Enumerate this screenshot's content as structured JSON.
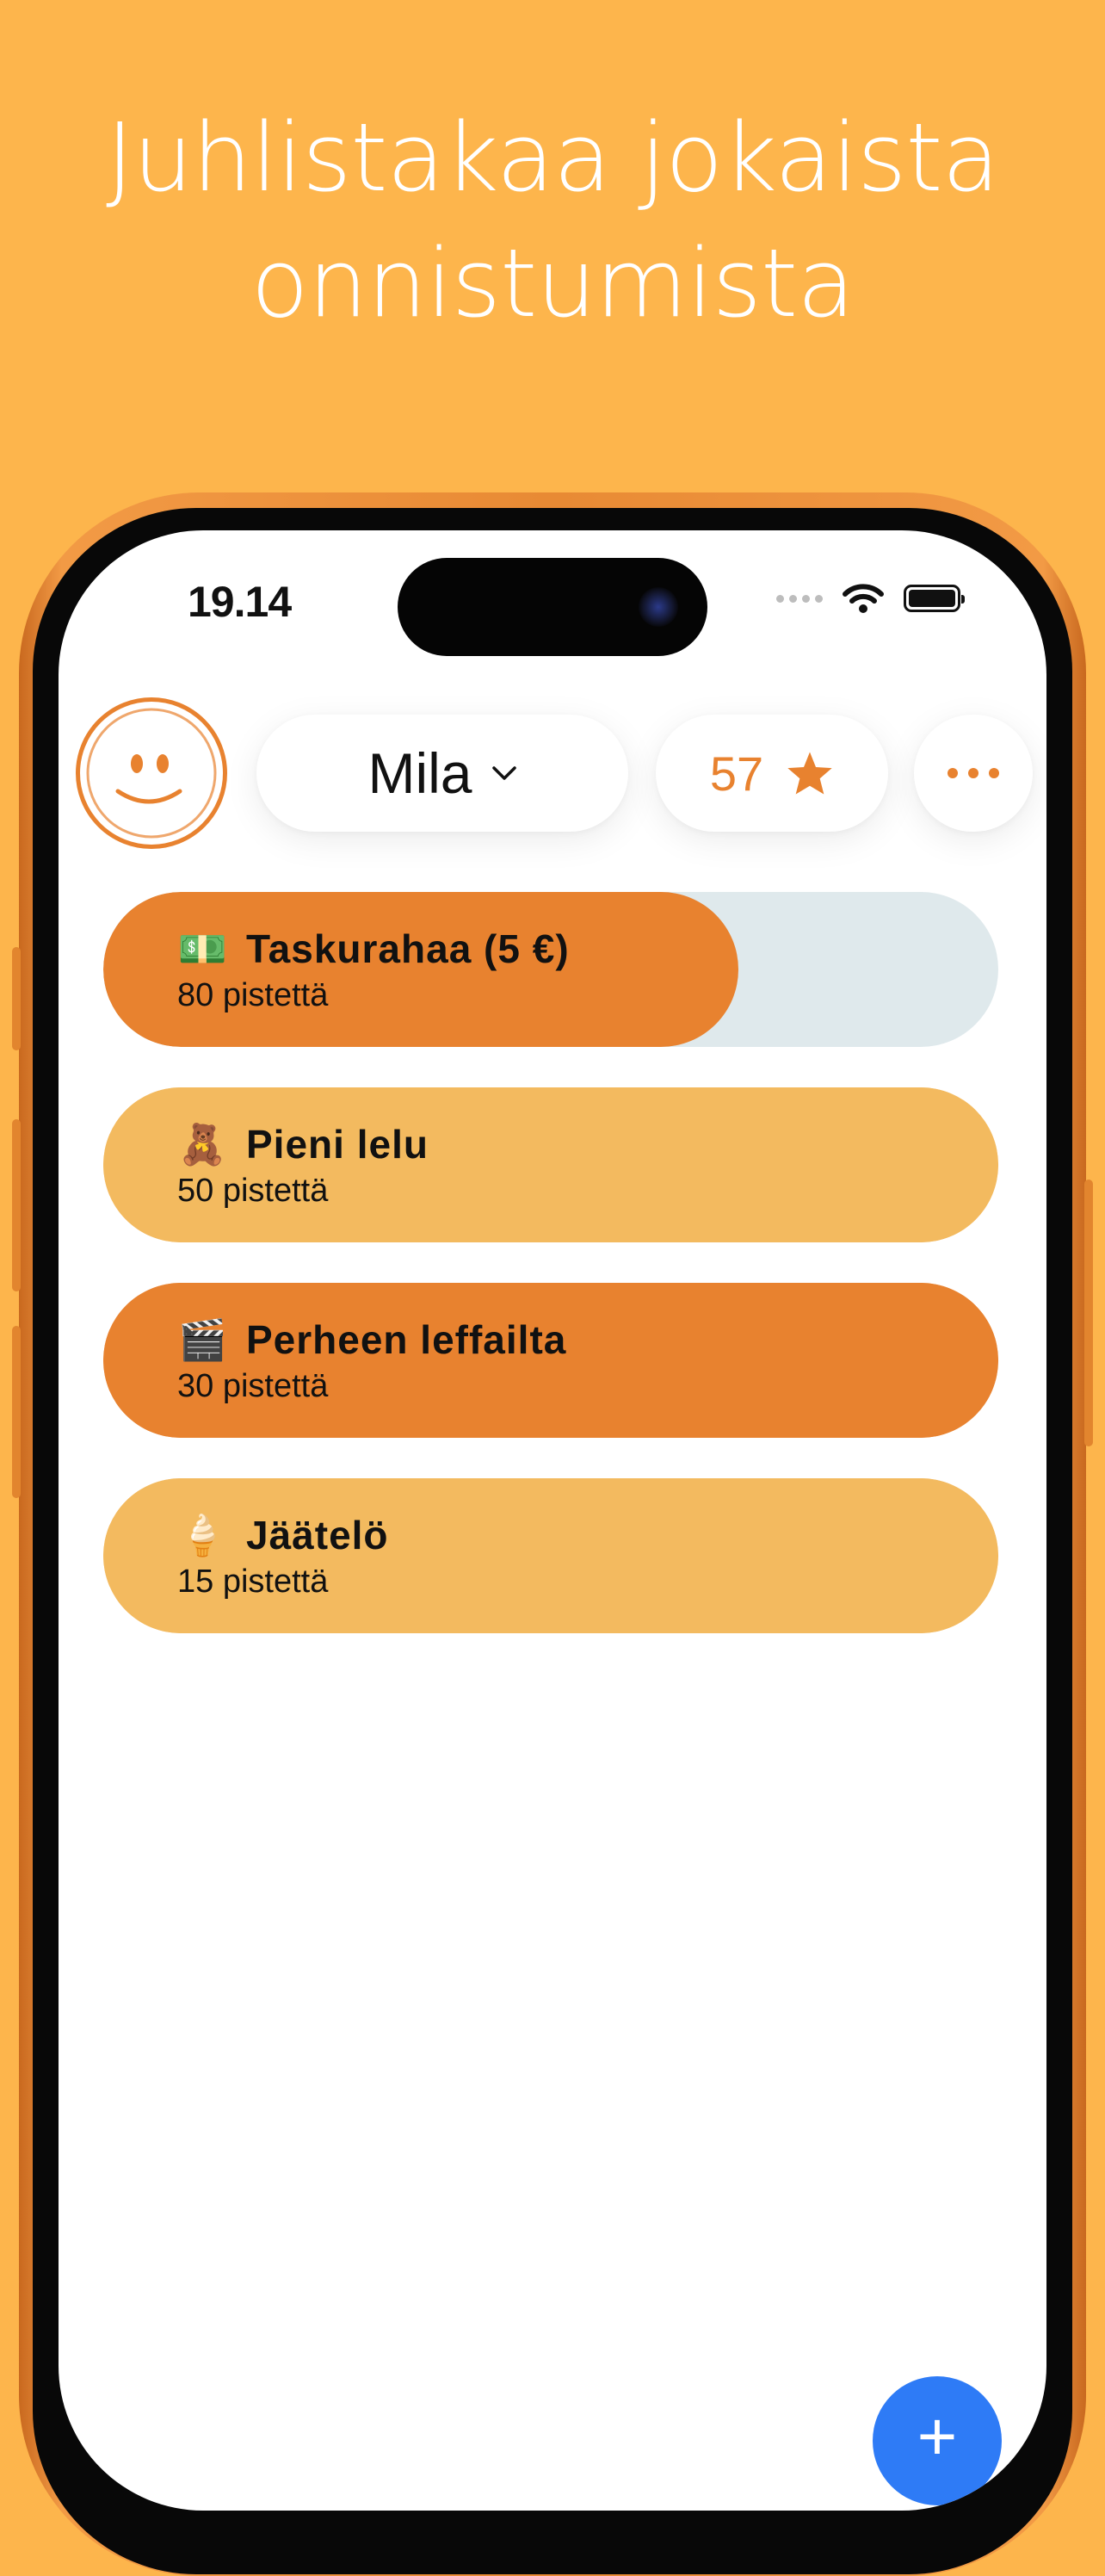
{
  "headline": {
    "line1": "Juhlistakaa jokaista",
    "line2": "onnistumista"
  },
  "status_bar": {
    "time": "19.14",
    "icons": [
      "signal-icon",
      "wifi-icon",
      "battery-icon"
    ]
  },
  "header": {
    "avatar_icon": "smiley-face-icon",
    "user_name": "Mila",
    "points_value": "57",
    "points_icon": "star-icon",
    "more_icon": "ellipsis-icon"
  },
  "rewards": [
    {
      "emoji": "💵",
      "title": "Taskurahaa (5 €)",
      "points": "80 pistettä",
      "progress": 0.71,
      "style": "progress"
    },
    {
      "emoji": "🧸",
      "title": "Pieni lelu",
      "points": "50 pistettä",
      "progress": 1.0,
      "style": "light"
    },
    {
      "emoji": "🎬",
      "title": "Perheen leffailta",
      "points": "30 pistettä",
      "progress": 1.0,
      "style": "dark"
    },
    {
      "emoji": "🍦",
      "title": "Jäätelö",
      "points": "15 pistettä",
      "progress": 1.0,
      "style": "light"
    }
  ],
  "fab": {
    "label": "+",
    "icon": "plus-icon"
  },
  "colors": {
    "background": "#FDB54C",
    "accent": "#E8822F",
    "reward_dark": "#E8822F",
    "reward_light": "#F3BA5F",
    "progress_track": "#DFE9EC",
    "fab": "#2E7BF6"
  }
}
